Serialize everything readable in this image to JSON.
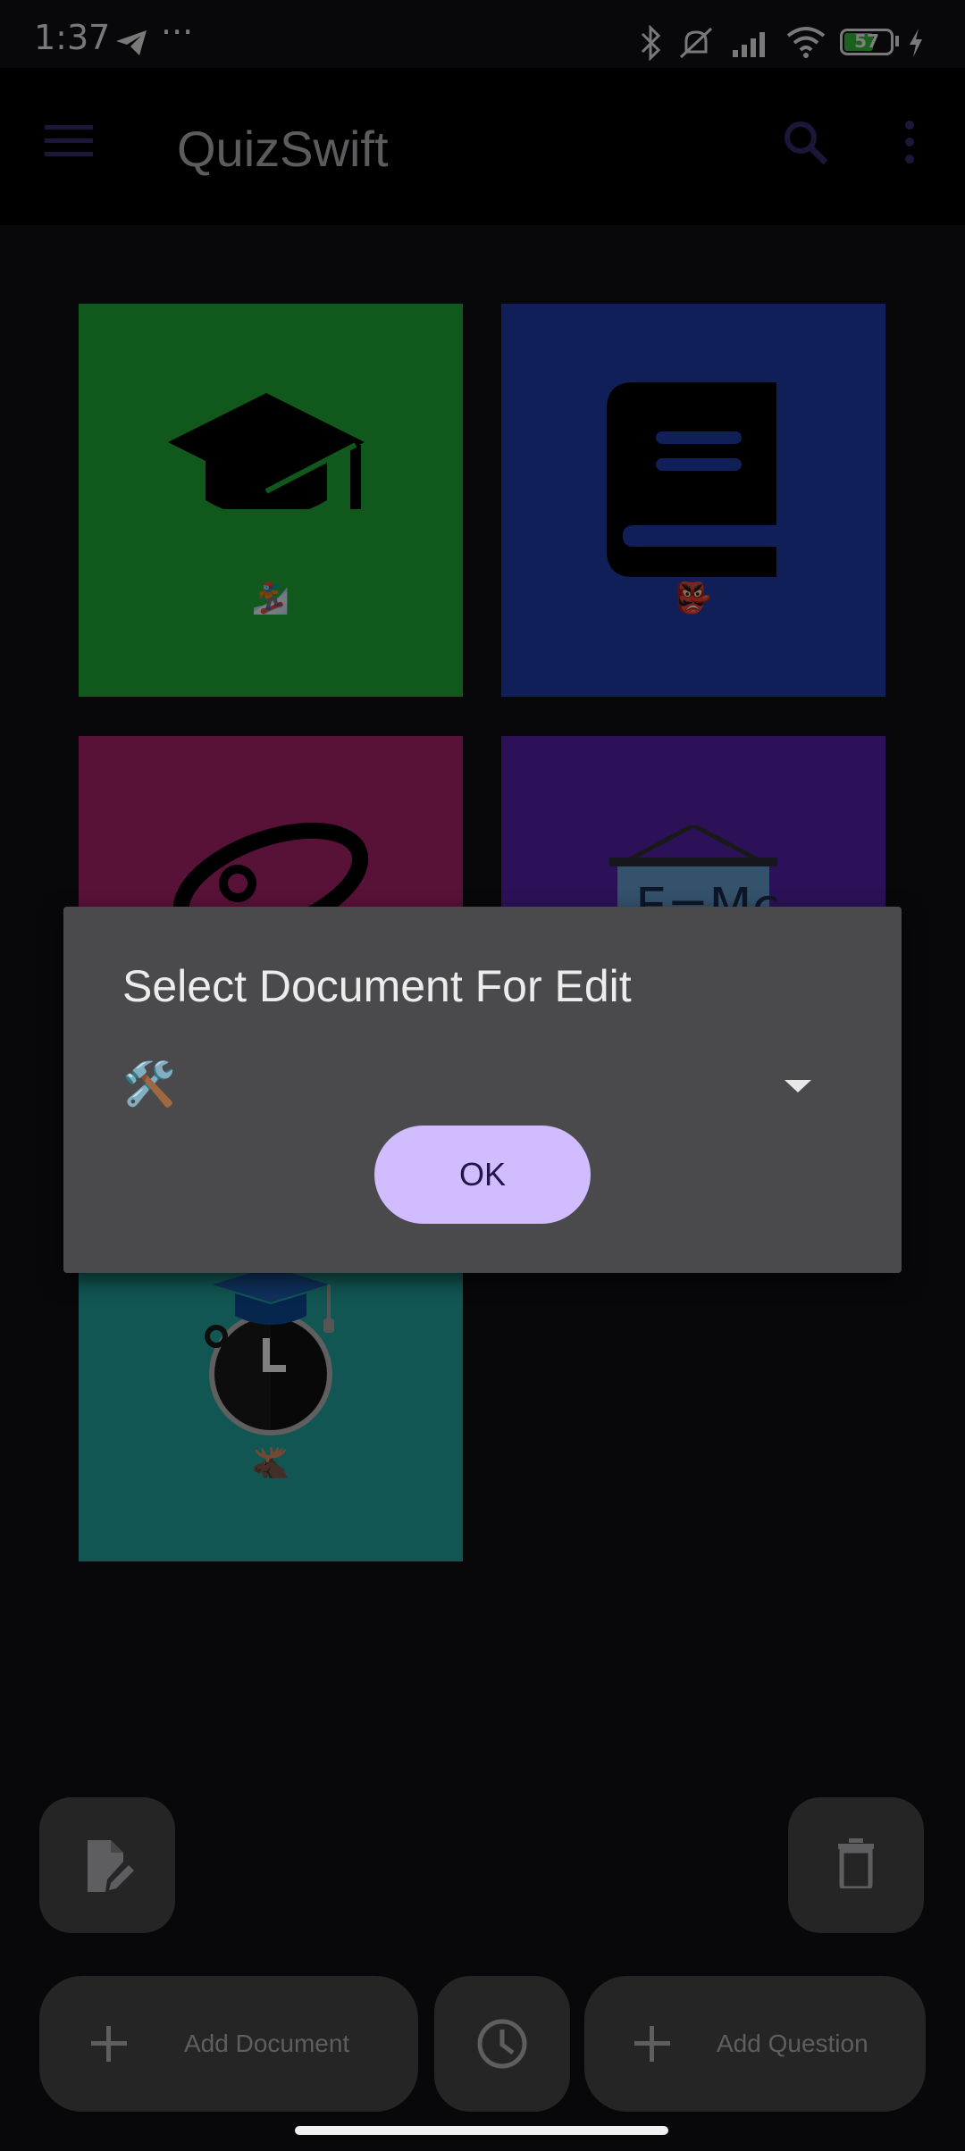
{
  "status_bar": {
    "time": "1:37",
    "more": "···",
    "battery": "57",
    "icons": [
      "telegram-icon",
      "bluetooth-icon",
      "mute-icon",
      "signal-icon",
      "wifi-icon",
      "battery-icon",
      "charging-icon"
    ]
  },
  "app_bar": {
    "title": "QuizSwift",
    "icons": [
      "menu-icon",
      "search-icon",
      "more-vert-icon"
    ]
  },
  "documents": [
    {
      "icon": "graduation-cap-icon",
      "emoji": "🏂",
      "color": "#22b03b"
    },
    {
      "icon": "book-icon",
      "emoji": "👺",
      "color": "#233fb1"
    },
    {
      "icon": "atom-icon",
      "emoji": "",
      "color": "#b02570"
    },
    {
      "icon": "formula-board-icon",
      "emoji": "",
      "color": "#5a22b0"
    },
    {
      "icon": "timer-cap-icon",
      "emoji": "🫎",
      "color": "#22aca4"
    }
  ],
  "dialog": {
    "title": "Select Document For Edit",
    "selected_value": "🛠️",
    "ok_label": "OK"
  },
  "bottom_bar": {
    "edit_icon": "edit-document-icon",
    "delete_icon": "delete-icon",
    "history_icon": "history-icon",
    "add_document_label": "Add Document",
    "add_question_label": "Add Question"
  }
}
